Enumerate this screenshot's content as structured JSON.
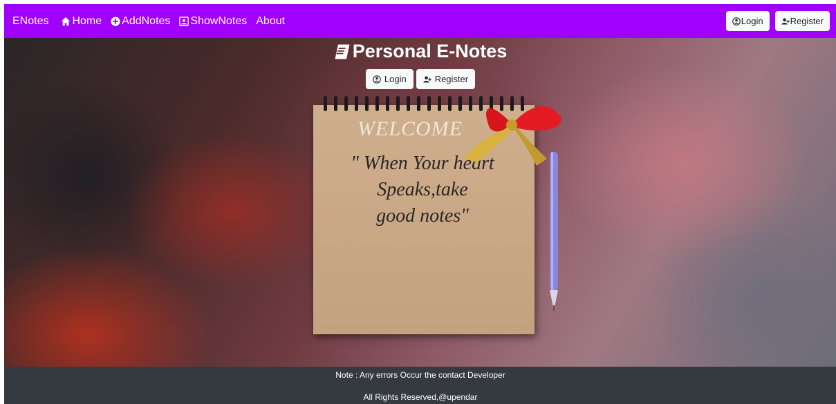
{
  "navbar": {
    "brand": "ENotes",
    "items": [
      {
        "label": "Home",
        "icon": "home-icon"
      },
      {
        "label": "AddNotes",
        "icon": "plus-circle-icon"
      },
      {
        "label": "ShowNotes",
        "icon": "notes-icon"
      },
      {
        "label": "About",
        "icon": ""
      }
    ],
    "login_label": "Login",
    "register_label": "Register",
    "background_color": "#a100ff"
  },
  "hero": {
    "title": "Personal E-Notes",
    "title_icon": "book-icon",
    "login_label": "Login",
    "register_label": "Register",
    "welcome": "WELCOME",
    "quote_lines": [
      "\" When Your heart",
      "Speaks,take",
      "good notes\""
    ]
  },
  "footer": {
    "note": "Note : Any errors Occur the contact Developer",
    "rights": "All Rights Reserved,@upendar",
    "background_color": "#343a40"
  }
}
